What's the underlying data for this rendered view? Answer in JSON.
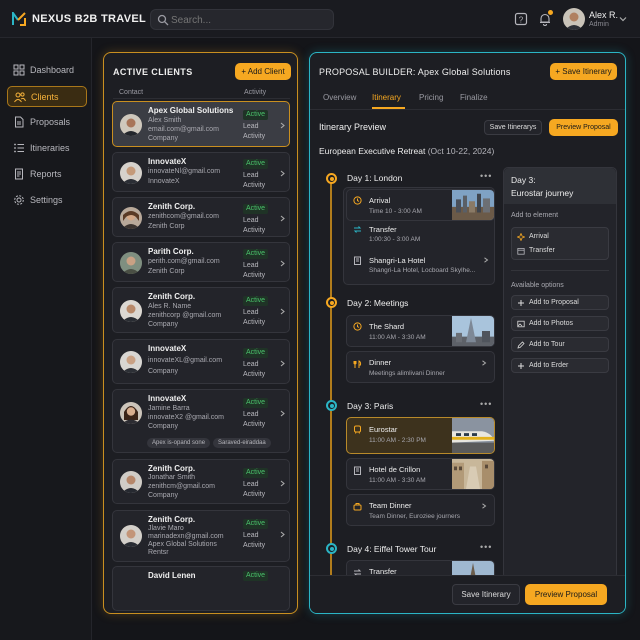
{
  "header": {
    "brand": "NEXUS B2B TRAVEL",
    "search_placeholder": "Search...",
    "user_name": "Alex R.",
    "user_role": "Admin"
  },
  "sidebar": {
    "items": [
      {
        "label": "Dashboard",
        "icon": "dashboard-icon"
      },
      {
        "label": "Clients",
        "icon": "users-icon",
        "active": true
      },
      {
        "label": "Proposals",
        "icon": "document-icon"
      },
      {
        "label": "Itineraries",
        "icon": "list-icon"
      },
      {
        "label": "Reports",
        "icon": "reports-icon"
      },
      {
        "label": "Settings",
        "icon": "gear-icon"
      }
    ]
  },
  "clients": {
    "title": "ACTIVE CLIENTS",
    "add_label": "+ Add Client",
    "col_contact": "Contact",
    "col_activity": "Activity",
    "list": [
      {
        "name": "Apex Global Solutions",
        "l1": "Alex Smith",
        "l2": "email.com@gmail.com",
        "l3": "Company",
        "status": "Active",
        "lead1": "Lead",
        "lead2": "Activity"
      },
      {
        "name": "InnovateX",
        "l1": "innovateNl@gmail.com",
        "l2": "InnovateX",
        "l3": "",
        "status": "Active",
        "lead1": "Lead",
        "lead2": "Activity"
      },
      {
        "name": "Zenith Corp.",
        "l1": "zenithcom@gmail.com",
        "l2": "Zenith Corp",
        "l3": "",
        "status": "Active",
        "lead1": "Lead",
        "lead2": "Activity"
      },
      {
        "name": "Parith Corp.",
        "l1": "perith.com@gmail.com",
        "l2": "Zenith Corp",
        "l3": "",
        "status": "Active",
        "lead1": "Lead",
        "lead2": "Activity"
      },
      {
        "name": "Zenith Corp.",
        "l1": "Ales R. Name",
        "l2": "zenithcorp @gmail.com",
        "l3": "Company",
        "status": "Active",
        "lead1": "Lead",
        "lead2": "Activity"
      },
      {
        "name": "InnovateX",
        "l1": "innovateXL@gmail.com",
        "l2": "Company",
        "l3": "",
        "status": "Active",
        "lead1": "Lead",
        "lead2": "Activity"
      },
      {
        "name": "InnovateX",
        "l1": "Jamine Barra",
        "l2": "innovateX2 @gmail.com",
        "l3": "Company",
        "status": "Active",
        "lead1": "Lead",
        "lead2": "Activity",
        "tags": [
          "Apex is-opand sone",
          "Saraved-eiraddaa"
        ]
      },
      {
        "name": "Zenith Corp.",
        "l1": "Jonathar Smith",
        "l2": "zenithcm@gmail.com",
        "l3": "Company",
        "status": "Active",
        "lead1": "Lead",
        "lead2": "Activity"
      },
      {
        "name": "Zenith Corp.",
        "l1": "Jlavie Maro",
        "l2": "marinadexn@gmail.com",
        "l3": "Apex Global Solutions",
        "l4": "Rentsr",
        "status": "Active",
        "lead1": "Lead",
        "lead2": "Activity"
      },
      {
        "name": "David Lenen",
        "l1": "",
        "l2": "",
        "l3": "",
        "status": "Active",
        "lead1": "",
        "lead2": ""
      }
    ]
  },
  "builder": {
    "title": "PROPOSAL BUILDER: Apex Global Solutions",
    "save_label": "+ Save Itinerary",
    "tabs": [
      "Overview",
      "Itinerary",
      "Pricing",
      "Finalize"
    ],
    "active_tab": "Itinerary",
    "preview_title": "Itinerary Preview",
    "preview_save": "Save Itinerarys",
    "preview_proposal": "Preview Proposal",
    "trip_name": "European Executive Retreat",
    "trip_dates": "(Oct 10-22, 2024)",
    "days": [
      {
        "title": "Day 1: London",
        "color": "#f6a821",
        "items": [
          {
            "name": "Arrival",
            "sub": "Time 10 - 3:00 AM",
            "icon": "clock-icon"
          },
          {
            "name": "Transfer",
            "sub": "1:00:30 - 3:00 AM",
            "icon": "transfer-icon"
          },
          {
            "name": "Shangri-La Hotel",
            "sub": "Shangri-La Hotel, Locboard Skylhe...",
            "icon": "hotel-icon"
          }
        ]
      },
      {
        "title": "Day 2: Meetings",
        "color": "#f6a821",
        "items": [
          {
            "name": "The Shard",
            "sub": "11:00 AM - 3:30 AM",
            "icon": "clock-icon"
          },
          {
            "name": "Dinner",
            "sub": "Meetings alimlivani Dinner",
            "icon": "dining-icon"
          }
        ]
      },
      {
        "title": "Day 3: Paris",
        "color": "#2bb5c5",
        "items": [
          {
            "name": "Eurostar",
            "sub": "11:00 AM - 2:30 PM",
            "icon": "train-icon"
          },
          {
            "name": "Hotel de Crillon",
            "sub": "11:00 AM - 3:30 AM",
            "icon": "hotel-icon"
          },
          {
            "name": "Team Dinner",
            "sub": "Team Dinner, Euroziee journers",
            "icon": "dining-icon"
          }
        ]
      },
      {
        "title": "Day 4: Eiffel Tower Tour",
        "color": "#2bb5c5",
        "items": [
          {
            "name": "Transfer",
            "sub": "",
            "icon": "transfer-icon"
          }
        ]
      }
    ],
    "side": {
      "head_l1": "Day 3:",
      "head_l2": "Eurostar journey",
      "add_label": "Add to element",
      "add_items": [
        "Arrival",
        "Transfer"
      ],
      "options_label": "Available options",
      "options": [
        "Add to Proposal",
        "Add to Photos",
        "Add to Tour",
        "Add to Erder"
      ]
    },
    "footer_save": "Save Itinerary",
    "footer_preview": "Preview Proposal"
  }
}
